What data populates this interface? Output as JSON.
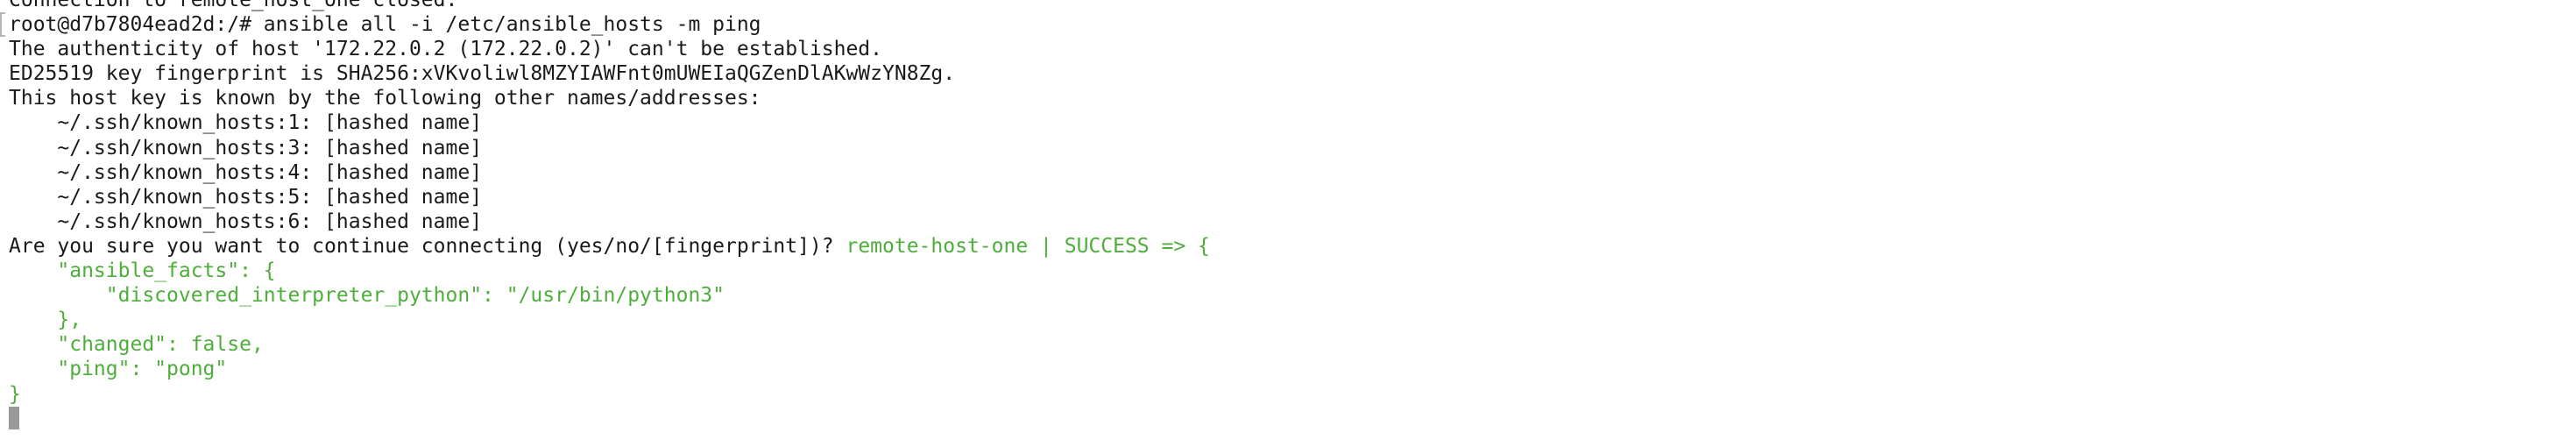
{
  "terminal": {
    "lines": [
      {
        "parts": [
          {
            "text": "Connection to remote_host_one closed.",
            "color": "black"
          }
        ]
      },
      {
        "parts": [
          {
            "text": "root@d7b7804ead2d:/# ansible all -i /etc/ansible_hosts -m ping",
            "color": "black"
          }
        ]
      },
      {
        "parts": [
          {
            "text": "The authenticity of host '172.22.0.2 (172.22.0.2)' can't be established.",
            "color": "black"
          }
        ]
      },
      {
        "parts": [
          {
            "text": "ED25519 key fingerprint is SHA256:xVKvoliwl8MZYIAWFnt0mUWEIaQGZenDlAKwWzYN8Zg.",
            "color": "black"
          }
        ]
      },
      {
        "parts": [
          {
            "text": "This host key is known by the following other names/addresses:",
            "color": "black"
          }
        ]
      },
      {
        "parts": [
          {
            "text": "    ~/.ssh/known_hosts:1: [hashed name]",
            "color": "black"
          }
        ]
      },
      {
        "parts": [
          {
            "text": "    ~/.ssh/known_hosts:3: [hashed name]",
            "color": "black"
          }
        ]
      },
      {
        "parts": [
          {
            "text": "    ~/.ssh/known_hosts:4: [hashed name]",
            "color": "black"
          }
        ]
      },
      {
        "parts": [
          {
            "text": "    ~/.ssh/known_hosts:5: [hashed name]",
            "color": "black"
          }
        ]
      },
      {
        "parts": [
          {
            "text": "    ~/.ssh/known_hosts:6: [hashed name]",
            "color": "black"
          }
        ]
      },
      {
        "parts": [
          {
            "text": "Are you sure you want to continue connecting (yes/no/[fingerprint])? ",
            "color": "black"
          },
          {
            "text": "remote-host-one | SUCCESS => {",
            "color": "green"
          }
        ]
      },
      {
        "parts": [
          {
            "text": "    \"ansible_facts\": {",
            "color": "green"
          }
        ]
      },
      {
        "parts": [
          {
            "text": "        \"discovered_interpreter_python\": \"/usr/bin/python3\"",
            "color": "green"
          }
        ]
      },
      {
        "parts": [
          {
            "text": "    },",
            "color": "green"
          }
        ]
      },
      {
        "parts": [
          {
            "text": "    \"changed\": false,",
            "color": "green"
          }
        ]
      },
      {
        "parts": [
          {
            "text": "    \"ping\": \"pong\"",
            "color": "green"
          }
        ]
      },
      {
        "parts": [
          {
            "text": "}",
            "color": "green"
          }
        ]
      }
    ],
    "cursor": "block-cursor",
    "colors": {
      "text": "#1a1a1a",
      "success": "#4eae3c",
      "background": "#ffffff",
      "cursor": "#9a9a9a"
    }
  }
}
